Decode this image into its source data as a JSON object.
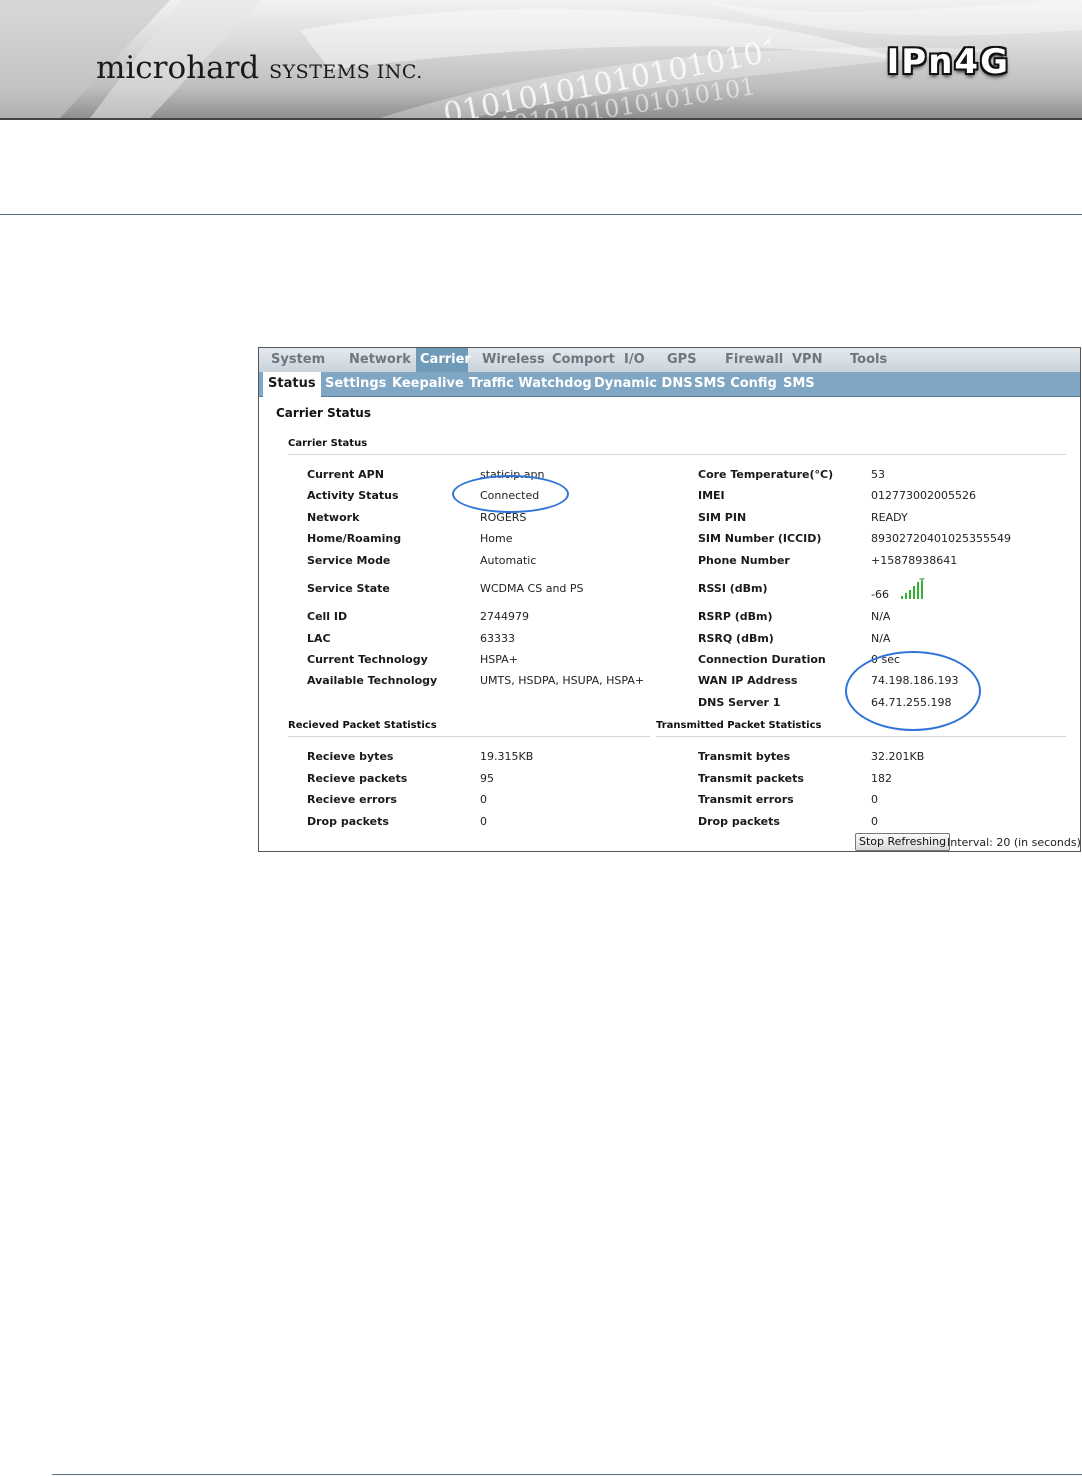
{
  "header": {
    "company": "microhard",
    "company_suffix": "SYSTEMS INC.",
    "product": "IPn4G",
    "binary_decoration": "01010101010101010101"
  },
  "nav": {
    "top_tabs": [
      "System",
      "Network",
      "Carrier",
      "Wireless",
      "Comport",
      "I/O",
      "GPS",
      "Firewall",
      "VPN",
      "Tools"
    ],
    "active_top": "Carrier",
    "sub_tabs": [
      "Status",
      "Settings",
      "Keepalive",
      "Traffic Watchdog",
      "Dynamic DNS",
      "SMS Config",
      "SMS"
    ],
    "active_sub": "Status"
  },
  "page": {
    "title": "Carrier Status",
    "carrier_section": "Carrier Status",
    "recv_section": "Recieved Packet Statistics",
    "trans_section": "Transmitted Packet Statistics"
  },
  "carrier_left": [
    {
      "label": "Current APN",
      "value": "staticip.apn"
    },
    {
      "label": "Activity Status",
      "value": "Connected"
    },
    {
      "label": "Network",
      "value": "ROGERS"
    },
    {
      "label": "Home/Roaming",
      "value": "Home"
    },
    {
      "label": "Service Mode",
      "value": "Automatic"
    },
    {
      "label": "Service State",
      "value": "WCDMA CS and PS"
    },
    {
      "label": "Cell ID",
      "value": "2744979"
    },
    {
      "label": "LAC",
      "value": "63333"
    },
    {
      "label": "Current Technology",
      "value": "HSPA+"
    },
    {
      "label": "Available Technology",
      "value": "UMTS, HSDPA, HSUPA, HSPA+"
    }
  ],
  "carrier_right": [
    {
      "label": "Core Temperature(°C)",
      "value": "53"
    },
    {
      "label": "IMEI",
      "value": "012773002005526"
    },
    {
      "label": "SIM PIN",
      "value": "READY"
    },
    {
      "label": "SIM Number (ICCID)",
      "value": "89302720401025355549"
    },
    {
      "label": "Phone Number",
      "value": "+15878938641"
    },
    {
      "label": "RSSI (dBm)",
      "value": "-66"
    },
    {
      "label": "RSRP (dBm)",
      "value": "N/A"
    },
    {
      "label": "RSRQ (dBm)",
      "value": "N/A"
    },
    {
      "label": "Connection Duration",
      "value": "0 sec"
    },
    {
      "label": "WAN IP Address",
      "value": "74.198.186.193"
    },
    {
      "label": "DNS Server 1",
      "value": "64.71.255.198"
    }
  ],
  "recv_stats": [
    {
      "label": "Recieve bytes",
      "value": "19.315KB"
    },
    {
      "label": "Recieve packets",
      "value": "95"
    },
    {
      "label": "Recieve errors",
      "value": "0"
    },
    {
      "label": "Drop packets",
      "value": "0"
    }
  ],
  "trans_stats": [
    {
      "label": "Transmit bytes",
      "value": "32.201KB"
    },
    {
      "label": "Transmit packets",
      "value": "182"
    },
    {
      "label": "Transmit errors",
      "value": "0"
    },
    {
      "label": "Drop packets",
      "value": "0"
    }
  ],
  "controls": {
    "stop_button": "Stop Refreshing",
    "interval_text": "Interval: 20 (in seconds)"
  },
  "icons": {
    "signal": "signal-strength-icon"
  },
  "colors": {
    "nav_active": "#6f9ab8",
    "subnav_bg": "#7fa6c3",
    "highlight_ring": "#2f73d8",
    "signal_bars": "#35b233"
  }
}
